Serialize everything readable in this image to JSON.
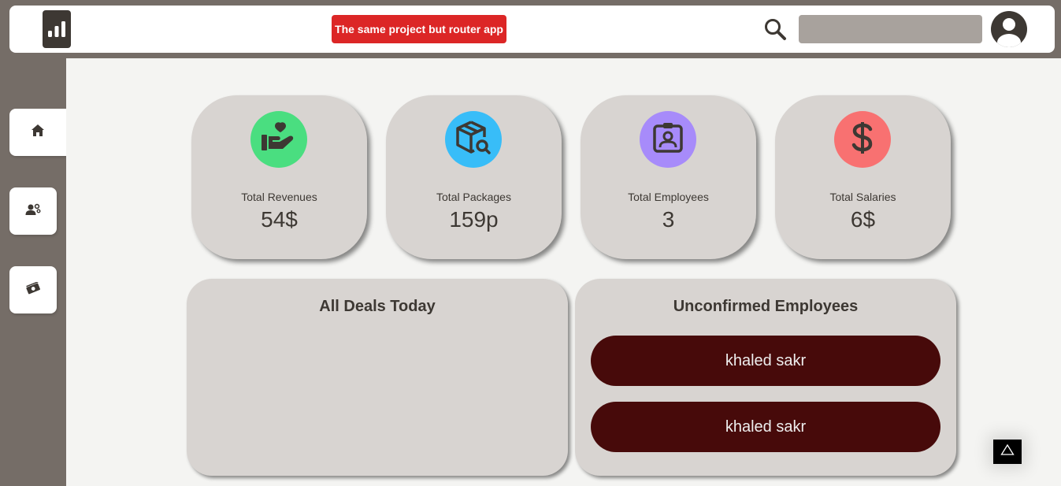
{
  "header": {
    "logo_icon": "bar-chart-icon",
    "banner_label": "The same project but router app",
    "search_placeholder": "",
    "search_icon": "search-icon",
    "avatar_icon": "user-avatar-icon"
  },
  "sidebar": {
    "items": [
      {
        "icon": "home-icon",
        "active": true
      },
      {
        "icon": "user-gear-icon",
        "active": false
      },
      {
        "icon": "money-icon",
        "active": false
      }
    ]
  },
  "stats": [
    {
      "label": "Total Revenues",
      "value": "54$",
      "icon": "hand-holding-heart-icon",
      "color": "#4ade80"
    },
    {
      "label": "Total Packages",
      "value": "159p",
      "icon": "package-search-icon",
      "color": "#38bdf8"
    },
    {
      "label": "Total Employees",
      "value": "3",
      "icon": "id-badge-icon",
      "color": "#a78bfa"
    },
    {
      "label": "Total Salaries",
      "value": "6$",
      "icon": "dollar-icon",
      "color": "#f87171"
    }
  ],
  "deals": {
    "title": "All Deals Today"
  },
  "unconfirmed": {
    "title": "Unconfirmed Employees",
    "employees": [
      "khaled sakr",
      "khaled sakr"
    ]
  },
  "colors": {
    "sidebar_bg": "#756d67",
    "main_bg": "#f4f4f2",
    "card_bg": "#d8d4d1",
    "banner_bg": "#dc2626",
    "employee_pill_bg": "#470a0a"
  }
}
